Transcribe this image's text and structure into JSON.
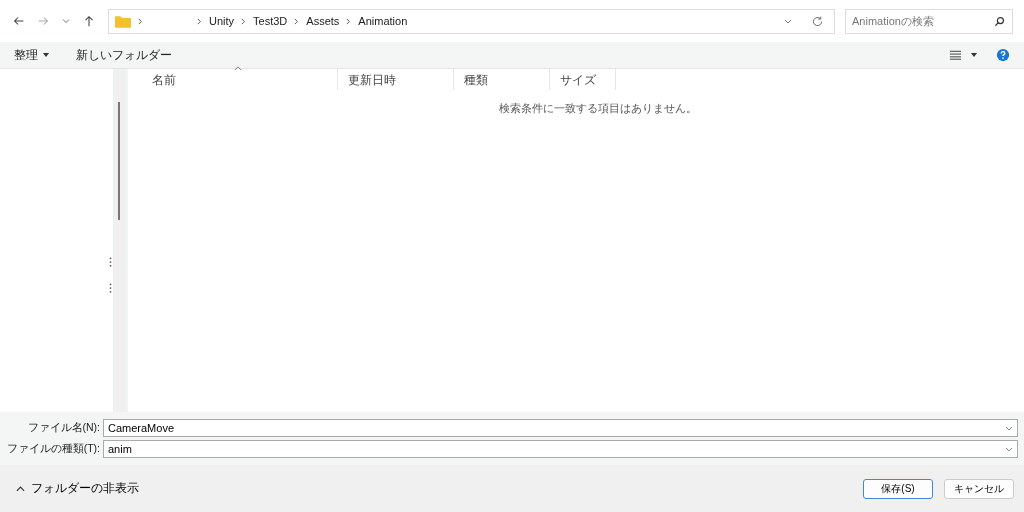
{
  "address_bar": {
    "crumbs": [
      "Unity",
      "Test3D",
      "Assets",
      "Animation"
    ]
  },
  "search": {
    "placeholder": "Animationの検索"
  },
  "toolbar": {
    "organize": "整理",
    "new_folder": "新しいフォルダー"
  },
  "table": {
    "columns": [
      {
        "label": "名前",
        "sorted": true
      },
      {
        "label": "更新日時",
        "sorted": false
      },
      {
        "label": "種類",
        "sorted": false
      },
      {
        "label": "サイズ",
        "sorted": false
      }
    ],
    "empty_message": "検索条件に一致する項目はありません。"
  },
  "form": {
    "fields": [
      {
        "label": "ファイル名(N):",
        "value": "CameraMove"
      },
      {
        "label": "ファイルの種類(T):",
        "value": "anim"
      }
    ]
  },
  "footer": {
    "toggle": "フォルダーの非表示",
    "buttons": [
      {
        "label": "保存(S)",
        "default": true
      },
      {
        "label": "キャンセル",
        "default": false
      }
    ]
  }
}
